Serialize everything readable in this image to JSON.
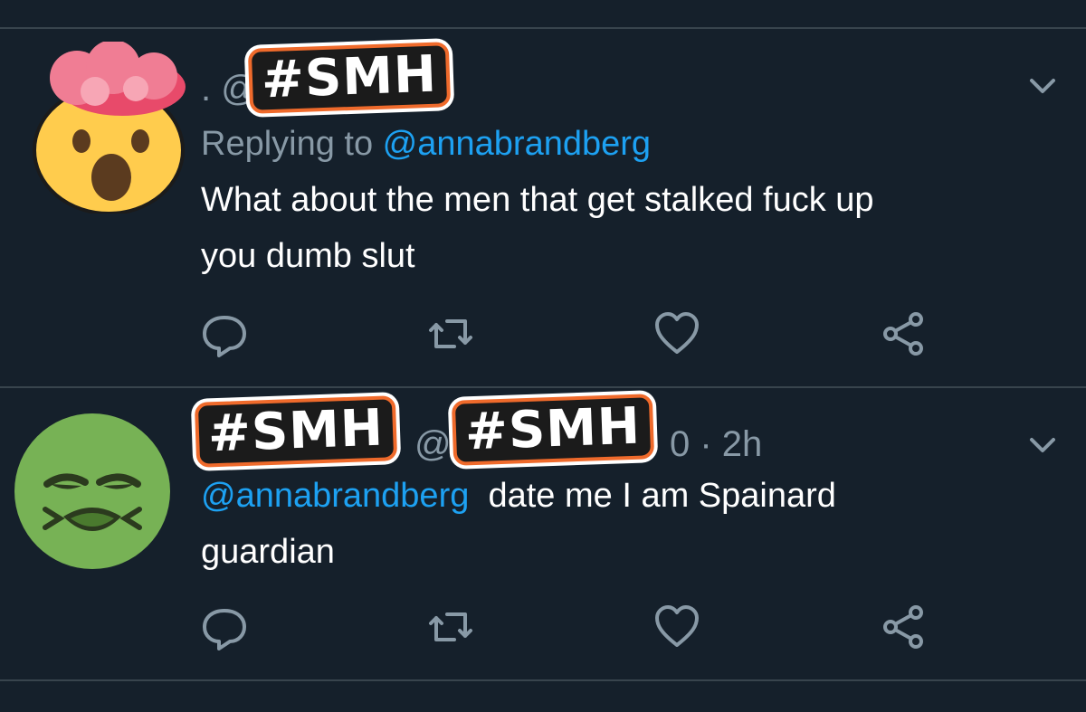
{
  "tweets": [
    {
      "handle_prefix": ". @",
      "sticker": "#SMH",
      "reply_prefix": "Replying to ",
      "reply_handle": "@annabrandberg",
      "text_line1": "What about the men that get stalked fuck up",
      "text_line2": "you dumb slut",
      "avatar_icon": "exploding-head-emoji-icon"
    },
    {
      "sticker_left": "#SMH",
      "sticker_right": "#SMH",
      "mid_fragment": "@",
      "time_fragment": "0 · 2h",
      "mention": "@annabrandberg",
      "text_after_mention": "date me I am Spainard",
      "text_line2": "guardian",
      "avatar_icon": "nauseated-face-emoji-icon"
    }
  ],
  "actions": [
    "reply-icon",
    "retweet-icon",
    "like-icon",
    "share-icon"
  ],
  "colors": {
    "background": "#15202b",
    "link": "#1da1f2",
    "muted": "#8899a6",
    "divider": "#38444d"
  }
}
